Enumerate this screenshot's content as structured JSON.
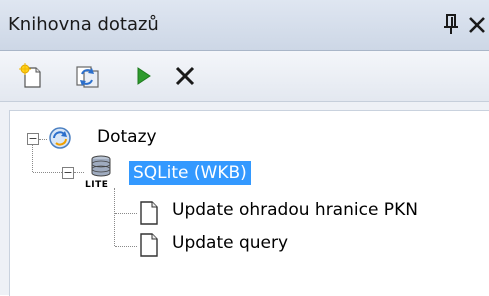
{
  "window": {
    "title": "Knihovna dotazů",
    "pin_glyph": "ᵽ",
    "close_glyph": "✕"
  },
  "toolbar": {
    "buttons": [
      {
        "name": "new-query-icon"
      },
      {
        "name": "refresh-icon"
      },
      {
        "name": "run-icon"
      },
      {
        "name": "delete-icon"
      }
    ]
  },
  "tree": {
    "root": {
      "label": "Dotazy",
      "expander": "−"
    },
    "db": {
      "label": "SQLite (WKB)",
      "expander": "−",
      "badge": "LITE"
    },
    "items": [
      {
        "label": "Update ohradou hranice PKN"
      },
      {
        "label": "Update query"
      }
    ]
  },
  "colors": {
    "selection": "#3399ff",
    "run_green": "#2e9b2e"
  }
}
